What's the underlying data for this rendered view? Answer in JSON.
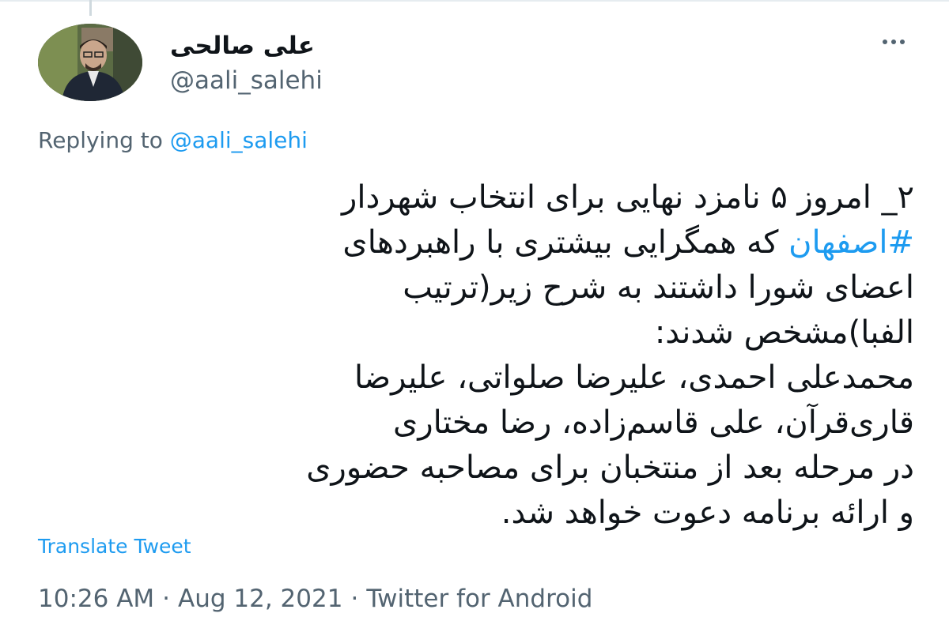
{
  "tweet": {
    "author": {
      "display_name": "علی صالحی",
      "handle": "@aali_salehi"
    },
    "replying_prefix": "Replying to",
    "replying_mention": "@aali_salehi",
    "body": {
      "line1": "۲_ امروز ۵ نامزد نهایی برای انتخاب شهردار",
      "hashtag": "#اصفهان",
      "line2_rest": " که همگرایی بیشتری با راهبردهای",
      "line3": "اعضای شورا داشتند به شرح زیر(ترتیب",
      "line4": "الفبا)مشخص شدند:",
      "line5": "محمدعلی احمدی، علیرضا صلواتی، علیرضا",
      "line6": "قاری‌قرآن، علی قاسم‌زاده، رضا مختاری",
      "line7": "در مرحله بعد از منتخبان برای مصاحبه حضوری",
      "line8": "و ارائه برنامه دعوت خواهد شد."
    },
    "translate_label": "Translate Tweet",
    "meta": {
      "time": "10:26 AM",
      "separator": "·",
      "date": "Aug 12, 2021",
      "source": "Twitter for Android"
    },
    "icons": {
      "more": "more-horizontal-icon",
      "avatar": "profile-avatar"
    },
    "colors": {
      "link": "#1d9bf0",
      "text": "#0f1419",
      "secondary": "#536471"
    }
  }
}
